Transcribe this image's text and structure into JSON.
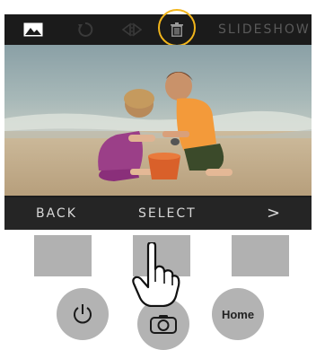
{
  "toolbar": {
    "icons": [
      "picture-icon",
      "rotate-icon",
      "flip-icon",
      "trash-icon"
    ],
    "slideshow_label": "SLIDESHOW",
    "highlighted": "trash-icon",
    "highlight_color": "#f2b51b"
  },
  "photo": {
    "description_icon": "beach-photo"
  },
  "bottom_bar": {
    "back_label": "BACK",
    "select_label": "SELECT",
    "next_label": ">"
  },
  "hardware": {
    "soft_keys": 3,
    "power_icon": "power-icon",
    "camera_icon": "camera-icon",
    "home_label": "Home"
  },
  "pointer": {
    "icon": "hand-pointer-icon"
  }
}
